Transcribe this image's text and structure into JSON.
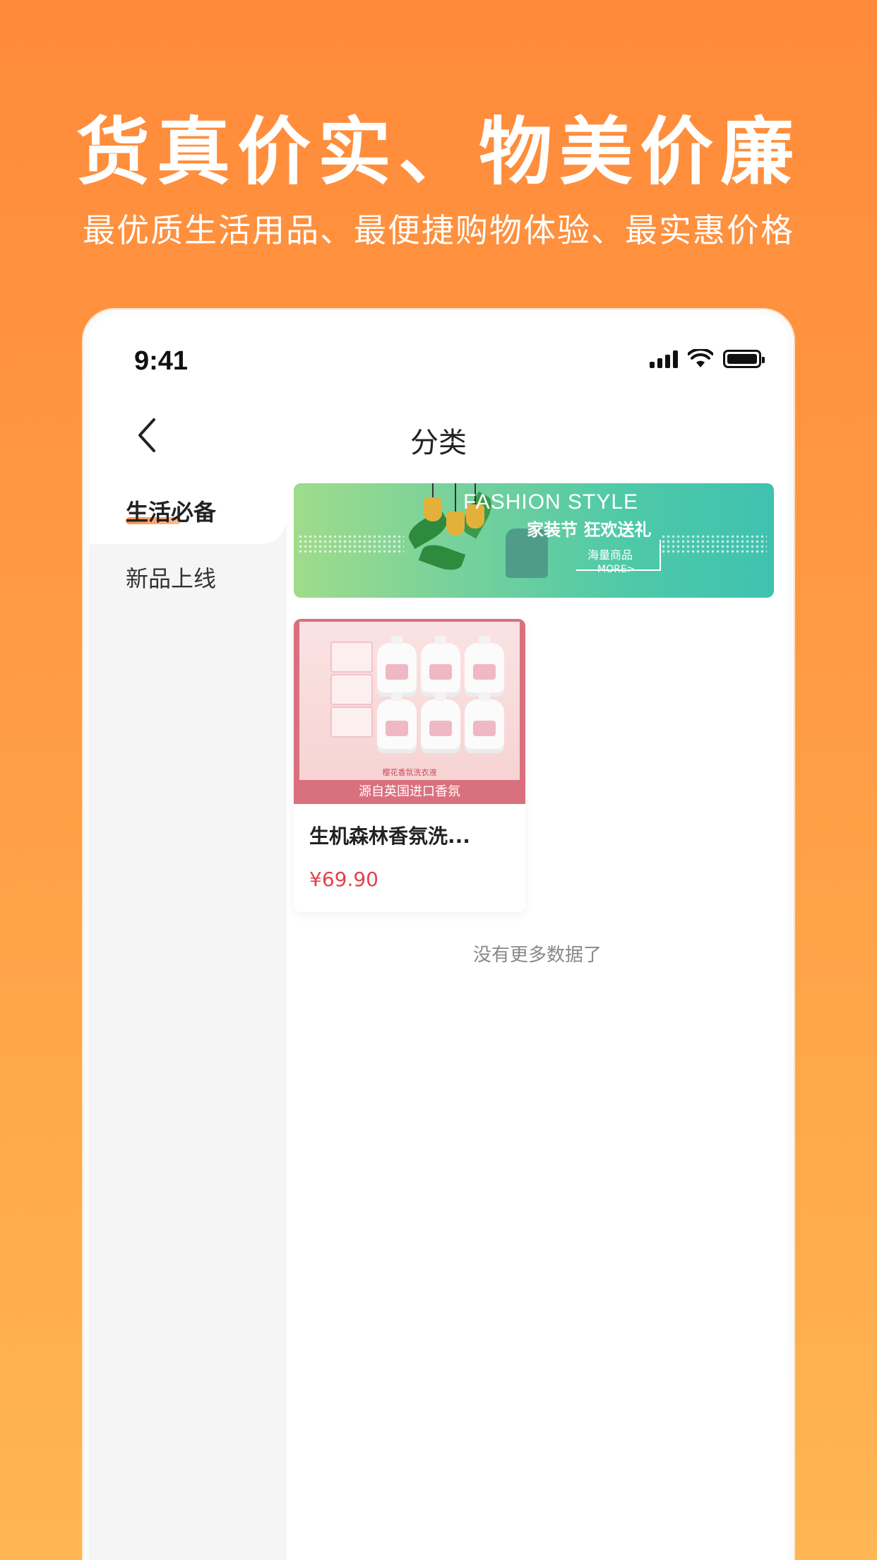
{
  "promo": {
    "headline": "货真价实、物美价廉",
    "subline": "最优质生活用品、最便捷购物体验、最实惠价格"
  },
  "status_bar": {
    "time": "9:41",
    "icons": [
      "signal-icon",
      "wifi-icon",
      "battery-icon"
    ]
  },
  "navbar": {
    "back_icon": "chevron-left-icon",
    "title": "分类"
  },
  "sidebar": {
    "items": [
      {
        "label": "生活必备",
        "active": true
      },
      {
        "label": "新品上线",
        "active": false
      }
    ]
  },
  "banner": {
    "title": "FASHION STYLE",
    "subtitle": "家装节 狂欢送礼",
    "tag": "海量商品",
    "more": "MORE>"
  },
  "products": [
    {
      "name": "生机森林香氛洗...",
      "price": "¥69.90",
      "image_caption_small": "樱花香氛洗衣液",
      "image_caption": "源自英国进口香氛"
    }
  ],
  "footer": {
    "no_more": "没有更多数据了"
  },
  "colors": {
    "background_top": "#ff8a3a",
    "background_bottom": "#ffb653",
    "price": "#e0434d",
    "sidebar_bg": "#f5f5f5"
  }
}
